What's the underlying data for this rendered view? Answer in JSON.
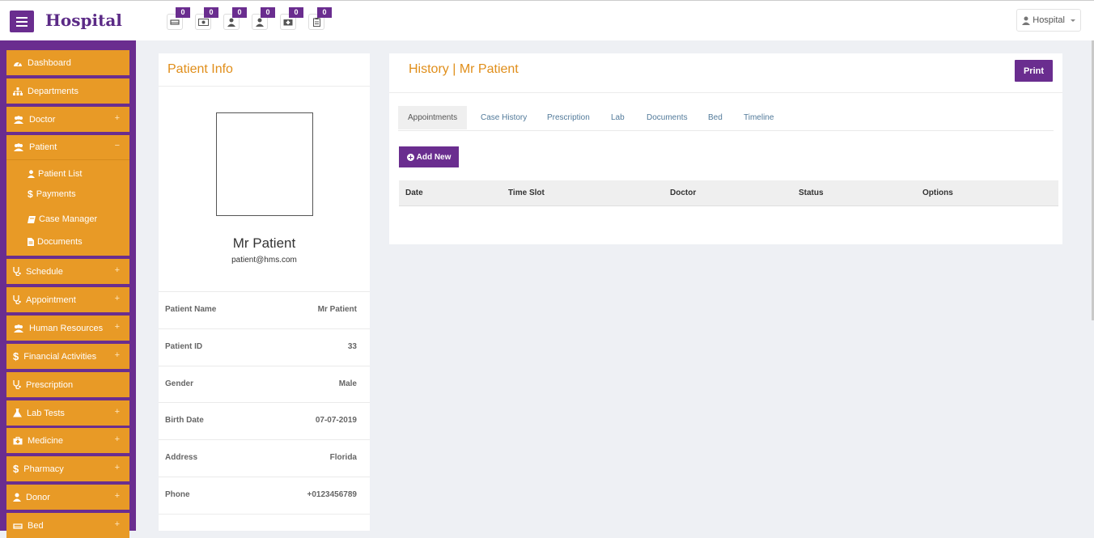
{
  "brand": "Hospital",
  "header": {
    "notifications": [
      {
        "icon": "bed-icon",
        "count": "0"
      },
      {
        "icon": "money-icon",
        "count": "0"
      },
      {
        "icon": "user-icon",
        "count": "0"
      },
      {
        "icon": "user-icon",
        "count": "0"
      },
      {
        "icon": "medkit-icon",
        "count": "0"
      },
      {
        "icon": "report-icon",
        "count": "0"
      }
    ],
    "user_label": "Hospital"
  },
  "sidebar": {
    "items": [
      {
        "label": "Dashboard",
        "icon": "dashboard-icon"
      },
      {
        "label": "Departments",
        "icon": "sitemap-icon"
      },
      {
        "label": "Doctor",
        "icon": "users-icon",
        "toggle": "+"
      },
      {
        "label": "Patient",
        "icon": "users-icon",
        "toggle": "−"
      },
      {
        "label": "Schedule",
        "icon": "stethoscope-icon",
        "toggle": "+"
      },
      {
        "label": "Appointment",
        "icon": "stethoscope-icon",
        "toggle": "+"
      },
      {
        "label": "Human Resources",
        "icon": "users-icon",
        "toggle": "+"
      },
      {
        "label": "Financial Activities",
        "icon": "dollar-icon",
        "toggle": "+"
      },
      {
        "label": "Prescription",
        "icon": "stethoscope-icon"
      },
      {
        "label": "Lab Tests",
        "icon": "flask-icon",
        "toggle": "+"
      },
      {
        "label": "Medicine",
        "icon": "medkit-icon",
        "toggle": "+"
      },
      {
        "label": "Pharmacy",
        "icon": "dollar-icon",
        "toggle": "+"
      },
      {
        "label": "Donor",
        "icon": "user-icon",
        "toggle": "+"
      },
      {
        "label": "Bed",
        "icon": "bed-icon",
        "toggle": "+"
      }
    ],
    "patient_sub": [
      {
        "label": "Patient List",
        "icon": "user-icon"
      },
      {
        "label": "Payments",
        "icon": "dollar-icon"
      },
      {
        "label": "Case Manager",
        "icon": "book-icon"
      },
      {
        "label": "Documents",
        "icon": "file-icon"
      }
    ]
  },
  "patient_info": {
    "title": "Patient Info",
    "name": "Mr Patient",
    "email": "patient@hms.com",
    "rows": [
      {
        "label": "Patient Name",
        "value": "Mr Patient"
      },
      {
        "label": "Patient ID",
        "value": "33"
      },
      {
        "label": "Gender",
        "value": "Male"
      },
      {
        "label": "Birth Date",
        "value": "07-07-2019"
      },
      {
        "label": "Address",
        "value": "Florida"
      },
      {
        "label": "Phone",
        "value": "+0123456789"
      }
    ]
  },
  "history": {
    "title": "History | Mr Patient",
    "print_label": "Print",
    "tabs": [
      "Appointments",
      "Case History",
      "Prescription",
      "Lab",
      "Documents",
      "Bed",
      "Timeline"
    ],
    "add_label": "Add New",
    "columns": [
      "Date",
      "Time Slot",
      "Doctor",
      "Status",
      "Options"
    ]
  },
  "colors": {
    "primary": "#6a2d8f",
    "sidebar_item": "#e89a26",
    "title": "#e08e1a"
  }
}
